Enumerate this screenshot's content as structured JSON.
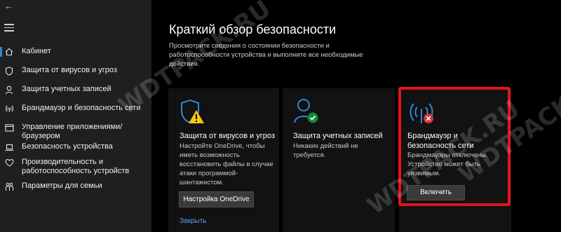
{
  "sidebar": {
    "items": [
      {
        "label": "Кабинет",
        "icon": "home-icon",
        "active": true
      },
      {
        "label": "Защита от вирусов и угроз",
        "icon": "shield-icon"
      },
      {
        "label": "Защита учетных записей",
        "icon": "person-icon"
      },
      {
        "label": "Брандмауэр и безопасность сети",
        "icon": "wifi-signal-icon"
      },
      {
        "label": "Управление приложениями/браузером",
        "icon": "app-window-icon"
      },
      {
        "label": "Безопасность устройства",
        "icon": "laptop-icon"
      },
      {
        "label": "Производительность и работоспособность устройств",
        "icon": "heart-icon"
      },
      {
        "label": "Параметры для семьи",
        "icon": "family-icon"
      }
    ]
  },
  "main": {
    "title": "Краткий обзор безопасности",
    "subtitle": "Просмотрите сведения о состоянии безопасности и работоспособности устройства и выполните все необходимые действия."
  },
  "cards": {
    "virus": {
      "title": "Защита от вирусов и угроз",
      "desc": "Настройте OneDrive, чтобы иметь возможность восстановить файлы в случае атаки программой-шантажистом.",
      "button": "Настройка OneDrive",
      "link": "Закрыть",
      "status": "warning"
    },
    "account": {
      "title": "Защита учетных записей",
      "desc": "Никаких действий не требуется.",
      "status": "ok"
    },
    "firewall": {
      "title": "Брандмауэр и безопасность сети",
      "desc": "Брандмауэры отключены. Устройство может быть уязвимым.",
      "button": "Включить",
      "status": "error"
    }
  },
  "watermarks": [
    "WDTPACK.RU",
    "WDTPACK.RU",
    "WDTPACK.RU"
  ],
  "colors": {
    "sidebar_bg": "#1f1f1f",
    "accent": "#2b88d8",
    "warning": "#f5c518",
    "ok": "#10893e",
    "error": "#d13438",
    "highlight": "#e3141b"
  }
}
